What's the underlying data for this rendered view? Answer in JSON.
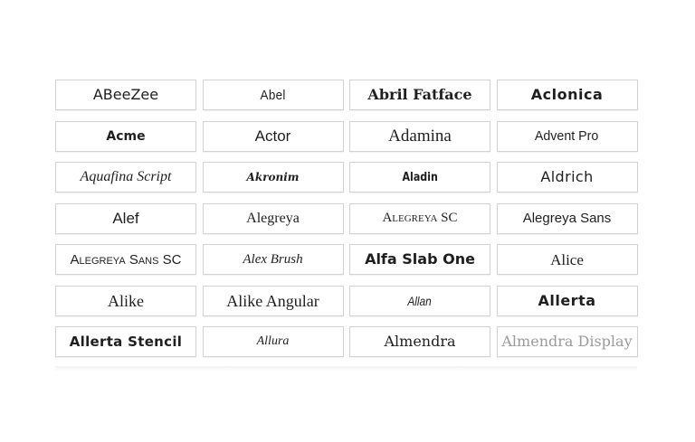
{
  "fonts": [
    "ABeeZee",
    "Abel",
    "Abril Fatface",
    "Aclonica",
    "Acme",
    "Actor",
    "Adamina",
    "Advent Pro",
    "Aquafina Script",
    "Akronim",
    "Aladin",
    "Aldrich",
    "Alef",
    "Alegreya",
    "Alegreya SC",
    "Alegreya Sans",
    "Alegreya Sans SC",
    "Alex Brush",
    "Alfa Slab One",
    "Alice",
    "Alike",
    "Alike Angular",
    "Allan",
    "Allerta",
    "Allerta Stencil",
    "Allura",
    "Almendra",
    "Almendra Display"
  ]
}
